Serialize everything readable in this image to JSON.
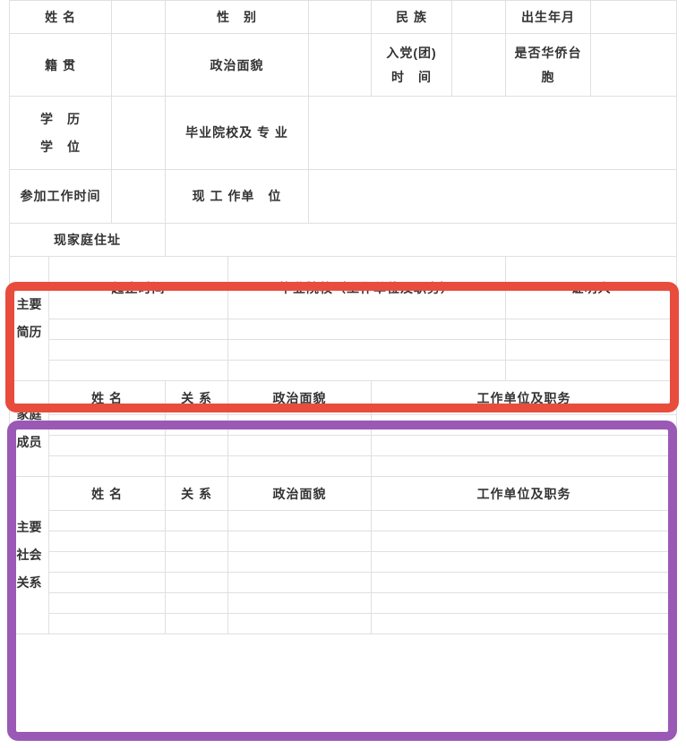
{
  "row1": {
    "name": "姓 名",
    "gender": "性　别",
    "ethnicity": "民 族",
    "birth": "出生年月"
  },
  "row2": {
    "native_place": "籍 贯",
    "political": "政治面貌",
    "party_date": "入党(团)\n时　间",
    "overseas": "是否华侨台胞"
  },
  "row3": {
    "edu": "学　历\n学　位",
    "school": "毕业院校及 专 业"
  },
  "row4": {
    "work_start": "参加工作时间",
    "current_unit": "现 工 作单　位"
  },
  "row5": {
    "address": "现家庭住址"
  },
  "resume": {
    "side": "主要简历",
    "col1": "起止时间",
    "col2": "毕业院校（工作单位及职务）",
    "col3": "证明人"
  },
  "family": {
    "side": "家庭成员",
    "name": "姓 名",
    "relation": "关 系",
    "political": "政治面貌",
    "unit": "工作单位及职务"
  },
  "social": {
    "side": "主要社会关系",
    "name": "姓 名",
    "relation": "关 系",
    "political": "政治面貌",
    "unit": "工作单位及职务"
  }
}
